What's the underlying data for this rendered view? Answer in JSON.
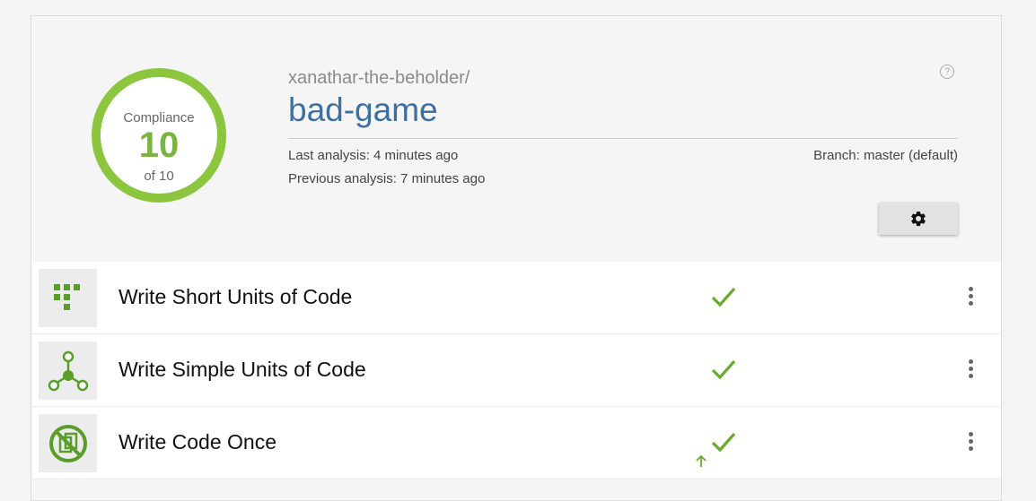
{
  "compliance": {
    "caption": "Compliance",
    "score": "10",
    "of_label": "of 10",
    "color": "#8cc63f"
  },
  "repository": {
    "owner": "xanathar-the-beholder/",
    "name": "bad-game",
    "last_analysis": "Last analysis: 4 minutes ago",
    "previous_analysis": "Previous analysis: 7 minutes ago",
    "branch": "Branch: master (default)"
  },
  "toolbar": {
    "help_icon": "help-icon",
    "help_glyph": "?",
    "settings_icon": "gear-icon"
  },
  "guidelines": [
    {
      "title": "Write Short Units of Code",
      "icon": "short-units-icon",
      "status": "passed"
    },
    {
      "title": "Write Simple Units of Code",
      "icon": "simple-units-icon",
      "status": "passed"
    },
    {
      "title": "Write Code Once",
      "icon": "no-duplication-icon",
      "status": "passed",
      "trend": "improved"
    }
  ],
  "colors": {
    "accent_green": "#6aaa2e",
    "link_blue": "#3e6fa1"
  }
}
